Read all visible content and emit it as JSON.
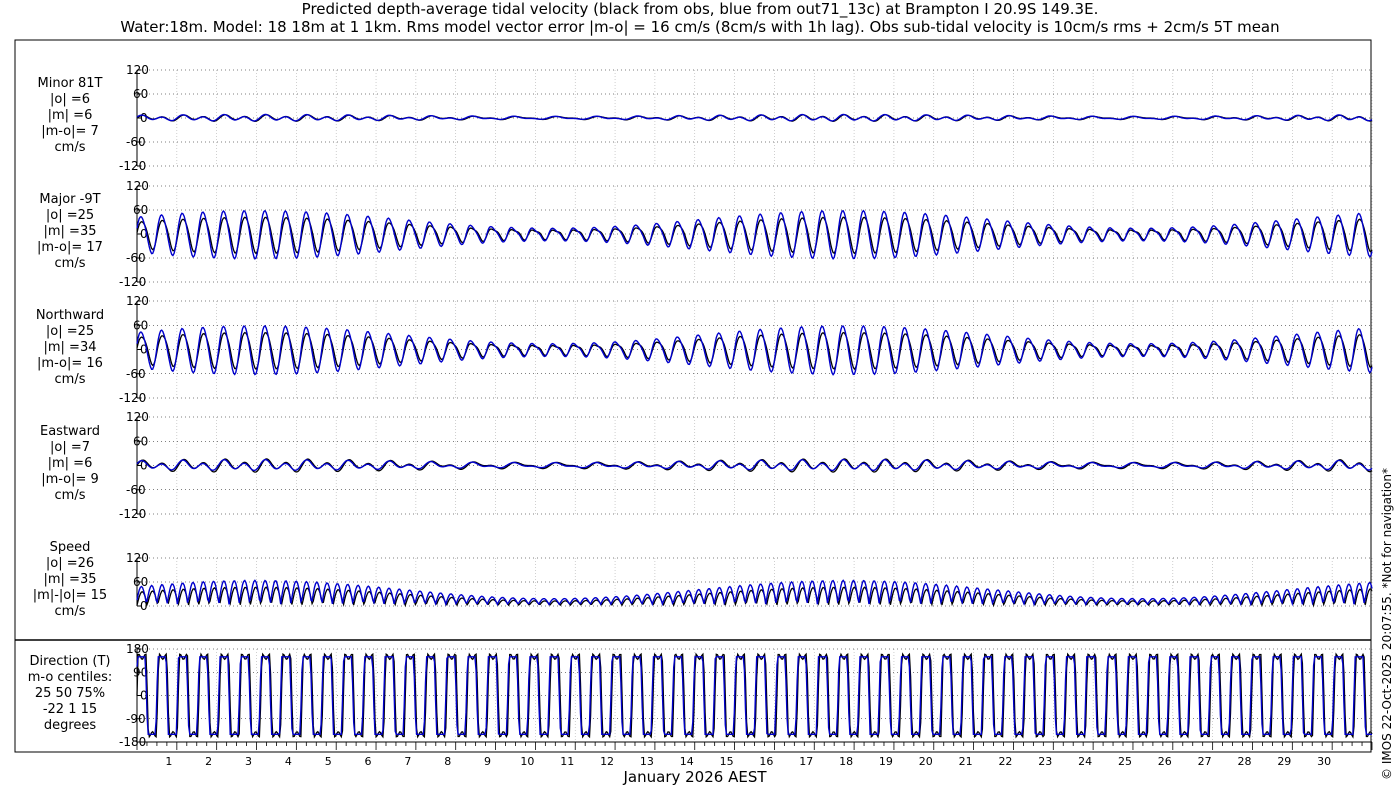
{
  "title_line1": "Predicted depth-average tidal velocity (black from obs, blue from out71_13c) at Brampton I 20.9S 149.3E.",
  "title_line2": "Water:18m. Model: 18 18m at 1 1km. Rms model vector error |m-o| = 16 cm/s (8cm/s with 1h lag). Obs sub-tidal velocity is 10cm/s rms + 2cm/s 5T mean",
  "xlabel": "January 2026 AEST",
  "copyright": "© IMOS 22-Oct-2025 20:07:55. *Not for navigation*",
  "colors": {
    "obs": "#000000",
    "model": "#0000cc"
  },
  "panel_labels": [
    {
      "name": "minor",
      "lines": [
        "Minor 81T",
        "|o| =6",
        "|m| =6",
        "|m-o|= 7",
        "cm/s"
      ]
    },
    {
      "name": "major",
      "lines": [
        "Major -9T",
        "|o| =25",
        "|m| =35",
        "|m-o|= 17",
        "cm/s"
      ]
    },
    {
      "name": "northward",
      "lines": [
        "Northward",
        "|o| =25",
        "|m| =34",
        "|m-o|= 16",
        "cm/s"
      ]
    },
    {
      "name": "eastward",
      "lines": [
        "Eastward",
        "|o| =7",
        "|m| =6",
        "|m-o|= 9",
        "cm/s"
      ]
    },
    {
      "name": "speed",
      "lines": [
        "Speed",
        "|o| =26",
        "|m| =35",
        "|m|-|o|= 15",
        "cm/s"
      ]
    },
    {
      "name": "direction",
      "lines": [
        "Direction (T)",
        "m-o centiles:",
        "25  50  75%",
        "-22   1  15",
        "degrees"
      ]
    }
  ],
  "chart_data": [
    {
      "type": "line",
      "panel": "Minor 81T",
      "ylim": [
        -120,
        120
      ],
      "yticks": [
        "120",
        "60",
        "0",
        "-60",
        "-120"
      ],
      "xlim": [
        0,
        31
      ],
      "grid": true,
      "series_colors": [
        "black",
        "blue"
      ],
      "approx_amplitude": {
        "obs": 6,
        "model": 6
      }
    },
    {
      "type": "line",
      "panel": "Major -9T",
      "ylim": [
        -120,
        120
      ],
      "yticks": [
        "120",
        "60",
        "0",
        "-60",
        "-120"
      ],
      "xlim": [
        0,
        31
      ],
      "grid": true,
      "series_colors": [
        "black",
        "blue"
      ],
      "approx_amplitude": {
        "obs": 45,
        "model": 60
      }
    },
    {
      "type": "line",
      "panel": "Northward",
      "ylim": [
        -120,
        120
      ],
      "yticks": [
        "120",
        "60",
        "0",
        "-60",
        "-120"
      ],
      "xlim": [
        0,
        31
      ],
      "grid": true,
      "series_colors": [
        "black",
        "blue"
      ],
      "approx_amplitude": {
        "obs": 45,
        "model": 60
      }
    },
    {
      "type": "line",
      "panel": "Eastward",
      "ylim": [
        -120,
        120
      ],
      "yticks": [
        "120",
        "60",
        "0",
        "-60",
        "-120"
      ],
      "xlim": [
        0,
        31
      ],
      "grid": true,
      "series_colors": [
        "black",
        "blue"
      ],
      "approx_amplitude": {
        "obs": 12,
        "model": 10
      }
    },
    {
      "type": "line",
      "panel": "Speed",
      "ylim": [
        0,
        120
      ],
      "yticks": [
        "120",
        "60",
        "0"
      ],
      "xlim": [
        0,
        31
      ],
      "grid": true,
      "series_colors": [
        "black",
        "blue"
      ],
      "approx_amplitude": {
        "obs": 45,
        "model": 60
      }
    },
    {
      "type": "line",
      "panel": "Direction (T)",
      "ylim": [
        -180,
        180
      ],
      "yticks": [
        "180",
        "90",
        "0",
        "-90",
        "-180"
      ],
      "xlim": [
        0,
        31
      ],
      "grid": true,
      "series_colors": [
        "black",
        "blue"
      ]
    }
  ],
  "x_ticks": [
    "1",
    "2",
    "3",
    "4",
    "5",
    "6",
    "7",
    "8",
    "9",
    "10",
    "11",
    "12",
    "13",
    "14",
    "15",
    "16",
    "17",
    "18",
    "19",
    "20",
    "21",
    "22",
    "23",
    "24",
    "25",
    "26",
    "27",
    "28",
    "29",
    "30"
  ]
}
